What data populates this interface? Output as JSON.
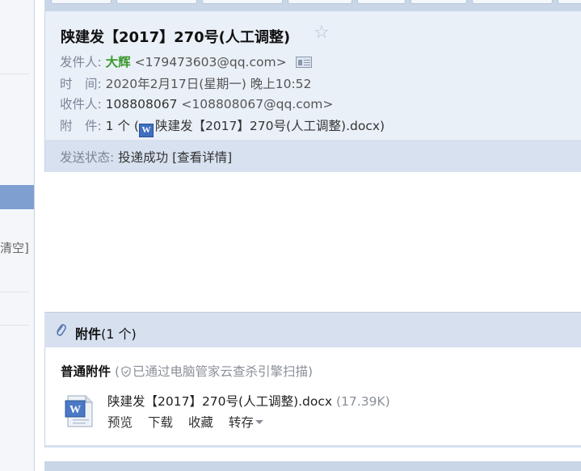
{
  "sidebar": {
    "clear_label": "清空]"
  },
  "mail": {
    "subject": "陕建发【2017】270号(人工调整)",
    "from_label": "发件人:",
    "from_name": "大辉",
    "from_addr": "<179473603@qq.com>",
    "time_label": "时　间:",
    "time_value": "2020年2月17日(星期一) 晚上10:52",
    "to_label": "收件人:",
    "to_name": "108808067",
    "to_addr": "<108808067@qq.com>",
    "attach_label": "附　件:",
    "attach_count": "1 个 (",
    "attach_name": "陕建发【2017】270号(人工调整).docx",
    "attach_close": ")"
  },
  "status": {
    "label": "发送状态:",
    "value": "投递成功",
    "detail": "[查看详情]"
  },
  "attachments": {
    "title": "附件",
    "count": "(1 个)",
    "normal_label": "普通附件",
    "scan_open": "(",
    "scan_note": "已通过电脑管家云查杀引擎扫描)",
    "file": {
      "name": "陕建发【2017】270号(人工调整).docx",
      "size": "(17.39K)"
    },
    "actions": {
      "preview": "预览",
      "download": "下载",
      "favorite": "收藏",
      "save_to": "转存"
    }
  },
  "icons": {
    "star": "star-icon",
    "contact": "contact-card-icon",
    "word": "word-doc-icon",
    "paperclip": "paperclip-icon",
    "shield": "shield-icon"
  },
  "colors": {
    "header_bg": "#eaf0f8",
    "status_bg": "#d7e1ef",
    "sender_name": "#3a9a2c",
    "sidebar_selected": "#7f9fd1"
  }
}
